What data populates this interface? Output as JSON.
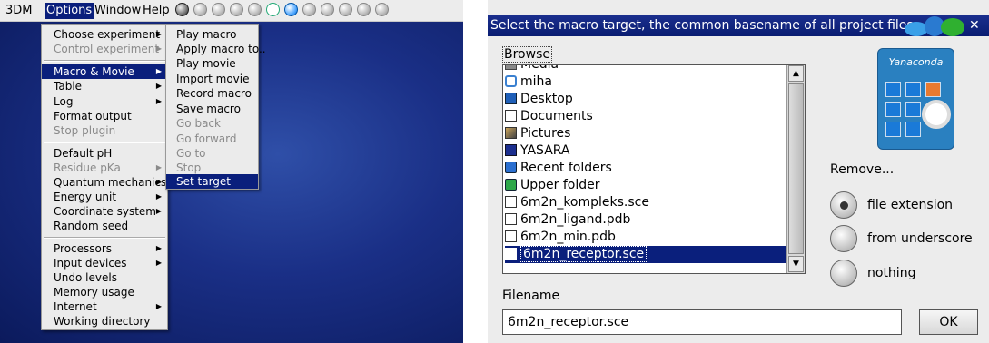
{
  "left": {
    "menubar": {
      "app": "3DM",
      "options": "Options",
      "window": "Window",
      "help": "Help"
    },
    "options_menu": {
      "items": [
        {
          "label": "Choose experiment",
          "arrow": "▶"
        },
        {
          "label": "Control experiment",
          "arrow": "▶"
        },
        {
          "label": "Macro & Movie",
          "arrow": "▶"
        },
        {
          "label": "Table",
          "arrow": "▶"
        },
        {
          "label": "Log",
          "arrow": "▶"
        },
        {
          "label": "Format output"
        },
        {
          "label": "Stop plugin"
        },
        {
          "label": "Default pH"
        },
        {
          "label": "Residue pKa",
          "arrow": "▶"
        },
        {
          "label": "Quantum mechanics",
          "arrow": "▶"
        },
        {
          "label": "Energy unit",
          "arrow": "▶"
        },
        {
          "label": "Coordinate system",
          "arrow": "▶"
        },
        {
          "label": "Random seed"
        },
        {
          "label": "Processors",
          "arrow": "▶"
        },
        {
          "label": "Input devices",
          "arrow": "▶"
        },
        {
          "label": "Undo levels"
        },
        {
          "label": "Memory usage"
        },
        {
          "label": "Internet",
          "arrow": "▶"
        },
        {
          "label": "Working directory"
        }
      ]
    },
    "macro_submenu": {
      "items": [
        {
          "label": "Play macro"
        },
        {
          "label": "Apply macro to.."
        },
        {
          "label": "Play movie"
        },
        {
          "label": "Import movie"
        },
        {
          "label": "Record macro"
        },
        {
          "label": "Save macro"
        },
        {
          "label": "Go back"
        },
        {
          "label": "Go forward"
        },
        {
          "label": "Go to"
        },
        {
          "label": "Stop"
        },
        {
          "label": "Set target"
        }
      ]
    },
    "toolbar_icons": [
      "gear-icon",
      "sphere-icon",
      "sphere-icon",
      "save-icon",
      "sphere-icon",
      "white-circle-icon",
      "blue-sphere-icon",
      "sphere-icon",
      "sphere-icon",
      "sphere-icon",
      "sphere-icon",
      "black-sphere-icon"
    ]
  },
  "dialog": {
    "title": "Select the macro target, the common basename of all project files",
    "browse_label": "Browse",
    "files": [
      {
        "name": "Media",
        "icon": "drive-icon"
      },
      {
        "name": "miha",
        "icon": "home-folder-icon"
      },
      {
        "name": "Desktop",
        "icon": "desktop-icon"
      },
      {
        "name": "Documents",
        "icon": "document-icon"
      },
      {
        "name": "Pictures",
        "icon": "picture-icon"
      },
      {
        "name": "YASARA",
        "icon": "yasara-icon"
      },
      {
        "name": "Recent folders",
        "icon": "recent-folder-icon"
      },
      {
        "name": "Upper folder",
        "icon": "upper-folder-icon"
      },
      {
        "name": "6m2n_kompleks.sce",
        "icon": "file-icon"
      },
      {
        "name": "6m2n_ligand.pdb",
        "icon": "file-icon"
      },
      {
        "name": "6m2n_min.pdb",
        "icon": "file-icon"
      },
      {
        "name": "6m2n_receptor.sce",
        "icon": "file-icon"
      }
    ],
    "filename_label": "Filename",
    "filename_value": "6m2n_receptor.sce",
    "ok_label": "OK",
    "logo_text": "Yanaconda",
    "remove_label": "Remove...",
    "options": [
      {
        "label": "file extension",
        "selected": true
      },
      {
        "label": "from underscore",
        "selected": false
      },
      {
        "label": "nothing",
        "selected": false
      }
    ]
  }
}
